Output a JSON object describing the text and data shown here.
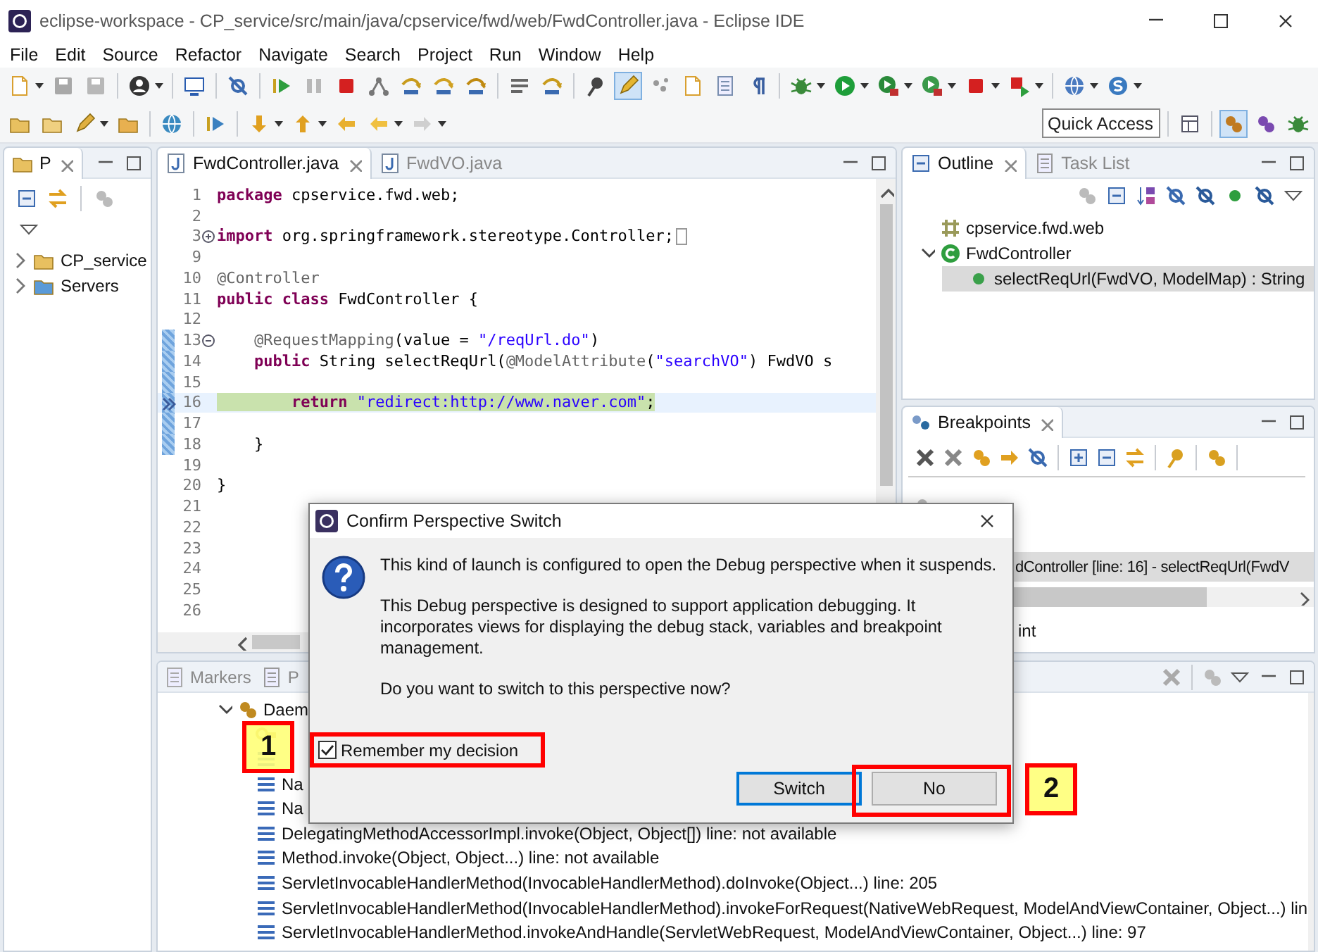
{
  "window": {
    "title": "eclipse-workspace - CP_service/src/main/java/cpservice/fwd/web/FwdController.java - Eclipse IDE"
  },
  "menu": [
    "File",
    "Edit",
    "Source",
    "Refactor",
    "Navigate",
    "Search",
    "Project",
    "Run",
    "Window",
    "Help"
  ],
  "quick_access": {
    "placeholder": "Quick Access"
  },
  "explorer": {
    "tabs": [
      {
        "label": "P",
        "selected": true
      }
    ],
    "items": [
      {
        "label": "CP_service",
        "kind": "project",
        "expanded": false
      },
      {
        "label": "Servers",
        "kind": "folder",
        "expanded": false
      }
    ]
  },
  "editor": {
    "tabs": [
      {
        "label": "FwdController.java",
        "selected": true
      },
      {
        "label": "FwdVO.java",
        "selected": false
      }
    ],
    "lines": [
      {
        "number": "1",
        "tokens": [
          {
            "kind": "kw",
            "text": "package"
          },
          {
            "kind": "plain",
            "text": " cpservice.fwd.web;"
          }
        ]
      },
      {
        "number": "2"
      },
      {
        "number": "3",
        "collapsed": true,
        "tokens": [
          {
            "kind": "kw",
            "text": "import"
          },
          {
            "kind": "plain",
            "text": " org.springframework.stereotype.Controller;"
          }
        ]
      },
      {
        "number": "9"
      },
      {
        "number": "10",
        "tokens": [
          {
            "kind": "ann",
            "text": "@Controller"
          }
        ]
      },
      {
        "number": "11",
        "tokens": [
          {
            "kind": "kw",
            "text": "public"
          },
          {
            "kind": "kw",
            "text": " class"
          },
          {
            "kind": "plain",
            "text": " FwdController {"
          }
        ]
      },
      {
        "number": "12"
      },
      {
        "number": "13",
        "collapsed": false,
        "range": true,
        "tokens": [
          {
            "kind": "ann",
            "text": "    @RequestMapping"
          },
          {
            "kind": "plain",
            "text": "(value = "
          },
          {
            "kind": "str",
            "text": "\"/reqUrl.do\""
          },
          {
            "kind": "plain",
            "text": ")"
          }
        ]
      },
      {
        "number": "14",
        "range": true,
        "tokens": [
          {
            "kind": "kw",
            "text": "    public"
          },
          {
            "kind": "plain",
            "text": " String selectReqUrl("
          },
          {
            "kind": "ann",
            "text": "@ModelAttribute"
          },
          {
            "kind": "plain",
            "text": "("
          },
          {
            "kind": "str",
            "text": "\"searchVO\""
          },
          {
            "kind": "plain",
            "text": ") FwdVO s"
          }
        ]
      },
      {
        "number": "15",
        "range": true
      },
      {
        "number": "16",
        "range": true,
        "current": true,
        "tokens": [
          {
            "kind": "kw",
            "text": "        return"
          },
          {
            "kind": "str",
            "text": " \"redirect:http://www.naver.com\""
          },
          {
            "kind": "plain",
            "text": ";"
          }
        ]
      },
      {
        "number": "17",
        "range": true
      },
      {
        "number": "18",
        "range": true,
        "tokens": [
          {
            "kind": "plain",
            "text": "    }"
          }
        ]
      },
      {
        "number": "19"
      },
      {
        "number": "20",
        "tokens": [
          {
            "kind": "plain",
            "text": "}"
          }
        ]
      },
      {
        "number": "21"
      },
      {
        "number": "22"
      },
      {
        "number": "23"
      },
      {
        "number": "24"
      },
      {
        "number": "25"
      },
      {
        "number": "26"
      }
    ]
  },
  "outline": {
    "tabs": [
      {
        "label": "Outline",
        "selected": true
      },
      {
        "label": "Task List",
        "selected": false
      }
    ],
    "items": [
      {
        "label": "cpservice.fwd.web",
        "kind": "package",
        "selected": false
      },
      {
        "label": "FwdController",
        "kind": "class",
        "expanded": true,
        "selected": false,
        "children": [
          {
            "label": "selectReqUrl(FwdVO, ModelMap) : String",
            "kind": "method",
            "selected": true
          }
        ]
      }
    ]
  },
  "breakpoints": {
    "tabs": [
      {
        "label": "Breakpoints",
        "selected": true
      }
    ],
    "items": [
      {
        "kind": "group",
        "selected": false
      },
      {
        "kind": "line",
        "label": "dController [line: 16] - selectReqUrl(FwdV",
        "selected": true
      }
    ],
    "detail": "int"
  },
  "debug": {
    "tabs": [
      {
        "label": "Markers",
        "selected": false
      },
      {
        "label": "P",
        "selected": false
      }
    ],
    "tree": [
      {
        "label": "Daem",
        "kind": "process",
        "expanded": true,
        "children": [
          {
            "kind": "thread"
          },
          {
            "kind": "frame"
          },
          {
            "kind": "frame",
            "label": "Na"
          },
          {
            "kind": "frame",
            "label": "Na"
          },
          {
            "kind": "frame",
            "label": "DelegatingMethodAccessorImpl.invoke(Object, Object[]) line: not available"
          },
          {
            "kind": "frame",
            "label": "Method.invoke(Object, Object...) line: not available"
          },
          {
            "kind": "frame",
            "label": "ServletInvocableHandlerMethod(InvocableHandlerMethod).doInvoke(Object...) line: 205"
          },
          {
            "kind": "frame",
            "label": "ServletInvocableHandlerMethod(InvocableHandlerMethod).invokeForRequest(NativeWebRequest, ModelAndViewContainer, Object...) lin"
          },
          {
            "kind": "frame",
            "label": "ServletInvocableHandlerMethod.invokeAndHandle(ServletWebRequest, ModelAndViewContainer, Object...) line: 97"
          }
        ]
      }
    ]
  },
  "dialog": {
    "title": "Confirm Perspective Switch",
    "paragraphs": [
      "This kind of launch is configured to open the Debug perspective when it suspends.",
      "This Debug perspective is designed to support application debugging.  It incorporates views for displaying the debug stack, variables and breakpoint management.",
      "Do you want to switch to this perspective now?"
    ],
    "checkbox": {
      "label": "Remember my decision",
      "checked": true,
      "outlined": true
    },
    "buttons": [
      {
        "label": "Switch",
        "default": true,
        "outlined": false
      },
      {
        "label": "No",
        "default": false,
        "outlined": true
      }
    ]
  },
  "callouts": [
    {
      "label": "1"
    },
    {
      "label": "2"
    }
  ]
}
